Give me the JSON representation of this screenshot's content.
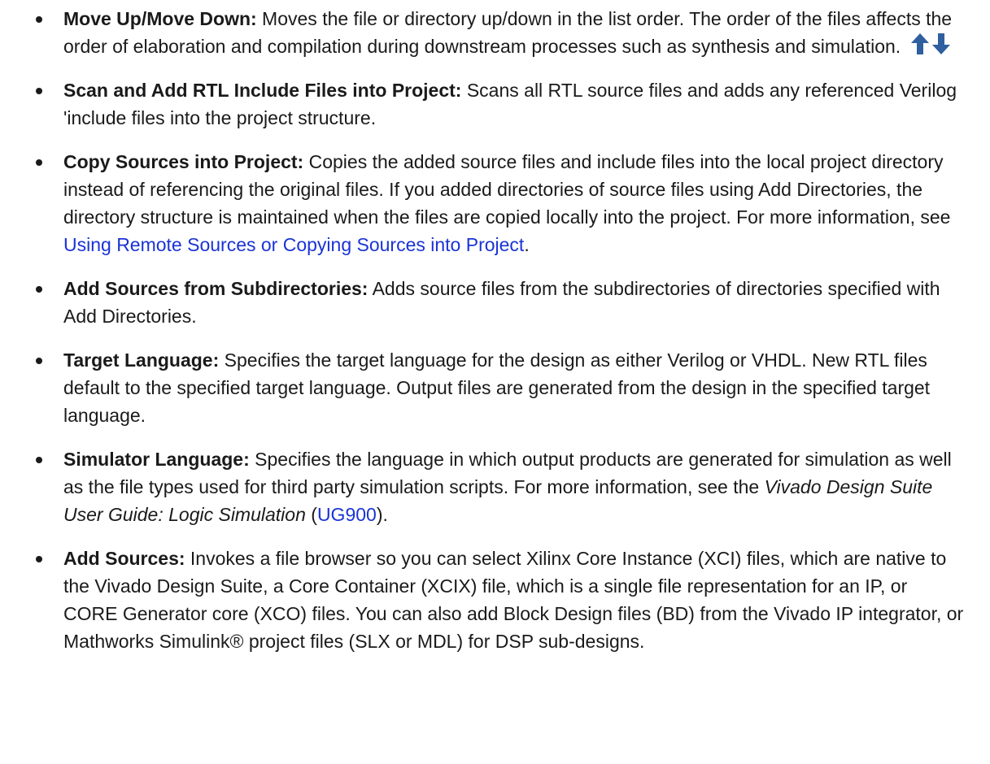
{
  "items": [
    {
      "term": "Move Up/Move Down:",
      "text": " Moves the file or directory up/down in the list order. The order of the files affects the order of elaboration and compilation during downstream processes such as synthesis and simulation.",
      "icons": [
        "arrow-up-icon",
        "arrow-down-icon"
      ]
    },
    {
      "term": "Scan and Add RTL Include Files into Project:",
      "text": " Scans all RTL source files and adds any referenced Verilog 'include files into the project structure."
    },
    {
      "term": "Copy Sources into Project:",
      "text": " Copies the added source files and include files into the local project directory instead of referencing the original files. If you added directories of source files using Add Directories, the directory structure is maintained when the files are copied locally into the project. For more information, see ",
      "link": "Using Remote Sources or Copying Sources into Project",
      "after": "."
    },
    {
      "term": "Add Sources from Subdirectories:",
      "text": " Adds source files from the subdirectories of directories specified with Add Directories."
    },
    {
      "term": "Target Language:",
      "text": " Specifies the target language for the design as either Verilog or VHDL. New RTL files default to the specified target language. Output files are generated from the design in the specified target language."
    },
    {
      "term": "Simulator Language:",
      "text": " Specifies the language in which output products are generated for simulation as well as the file types used for third party simulation scripts. For more information, see the ",
      "emph": "Vivado Design Suite User Guide: Logic Simulation",
      "before_link": " (",
      "link": "UG900",
      "after": ")."
    },
    {
      "term": "Add Sources:",
      "text": " Invokes a file browser so you can select Xilinx Core Instance (XCI) files, which are native to the Vivado Design Suite, a Core Container (XCIX) file, which is a single file representation for an IP, or CORE Generator core (XCO) files. You can also add Block Design files (BD) from the Vivado IP integrator, or Mathworks Simulink® project files (SLX or MDL) for DSP sub-designs."
    }
  ],
  "colors": {
    "link": "#1a33d6",
    "arrow": "#2f5f9e"
  }
}
